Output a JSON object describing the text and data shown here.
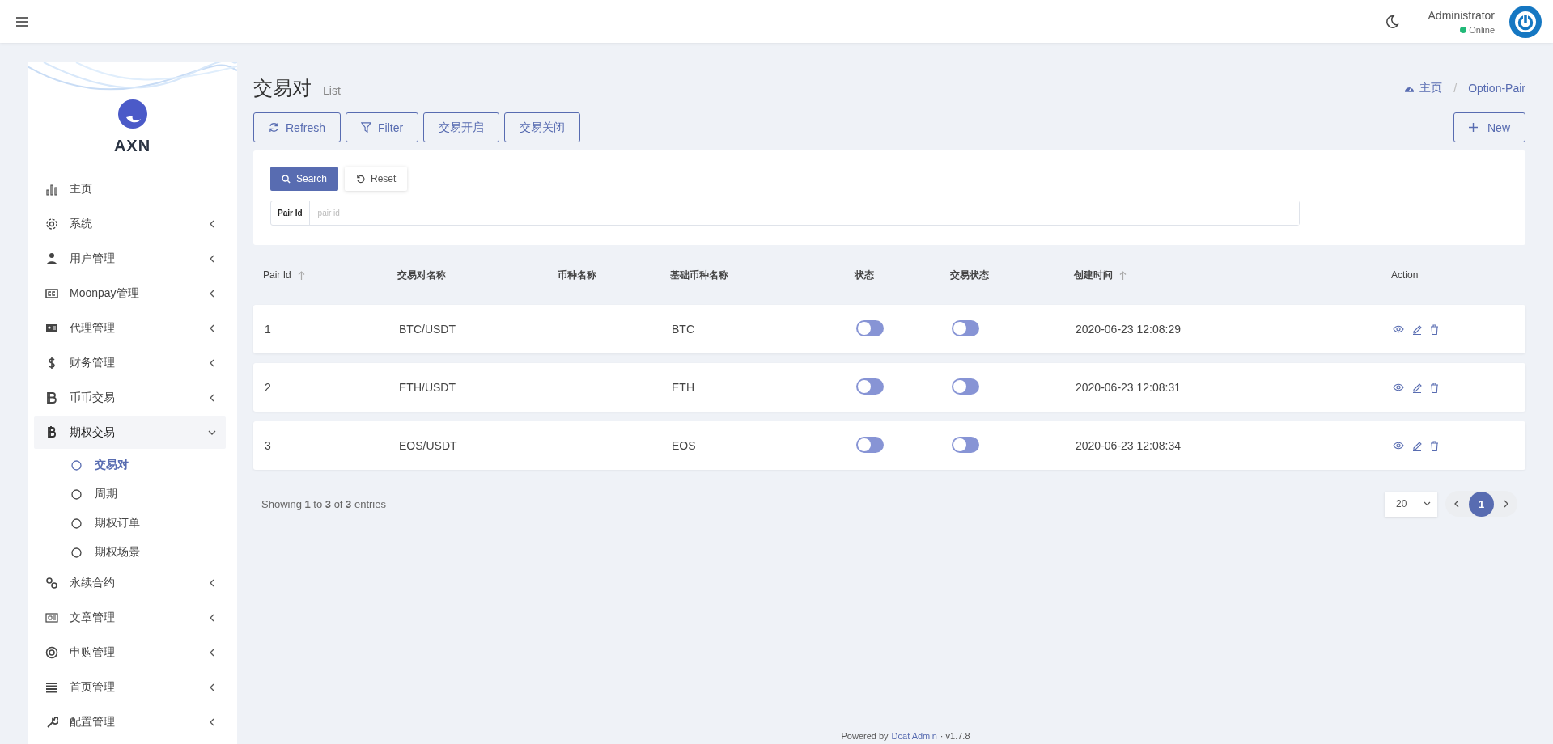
{
  "header": {
    "user_name": "Administrator",
    "user_status": "Online"
  },
  "sidebar": {
    "brand": "AXN",
    "items": [
      {
        "label": "主页",
        "selected": false
      },
      {
        "label": "系统",
        "selected": false,
        "expanded": false
      },
      {
        "label": "用户管理",
        "selected": false,
        "expanded": false
      },
      {
        "label": "Moonpay管理",
        "selected": false,
        "expanded": false
      },
      {
        "label": "代理管理",
        "selected": false,
        "expanded": false
      },
      {
        "label": "财务管理",
        "selected": false,
        "expanded": false
      },
      {
        "label": "币币交易",
        "selected": false,
        "expanded": false
      },
      {
        "label": "期权交易",
        "selected": true,
        "expanded": true,
        "children": [
          {
            "label": "交易对",
            "selected": true
          },
          {
            "label": "周期",
            "selected": false
          },
          {
            "label": "期权订单",
            "selected": false
          },
          {
            "label": "期权场景",
            "selected": false
          }
        ]
      },
      {
        "label": "永续合约",
        "selected": false,
        "expanded": false
      },
      {
        "label": "文章管理",
        "selected": false,
        "expanded": false
      },
      {
        "label": "申购管理",
        "selected": false,
        "expanded": false
      },
      {
        "label": "首页管理",
        "selected": false,
        "expanded": false
      },
      {
        "label": "配置管理",
        "selected": false,
        "expanded": false
      }
    ]
  },
  "page": {
    "title": "交易对",
    "subtitle": "List",
    "breadcrumb": [
      "主页",
      "Option-Pair"
    ],
    "breadcrumb_separator": "/"
  },
  "toolbar": {
    "buttons": [
      {
        "label": "Refresh",
        "kind": "refresh"
      },
      {
        "label": "Filter",
        "kind": "filter"
      },
      {
        "label": "交易开启",
        "kind": "plain"
      },
      {
        "label": "交易关闭",
        "kind": "plain"
      }
    ],
    "new_button": "New"
  },
  "filter": {
    "search_button": "Search",
    "reset_button": "Reset",
    "field_label": "Pair Id",
    "placeholder": "pair id"
  },
  "table": {
    "columns": [
      {
        "label": "Pair Id",
        "sortable": true
      },
      {
        "label": "交易对名称",
        "sortable": false
      },
      {
        "label": "币种名称",
        "sortable": false
      },
      {
        "label": "基础币种名称",
        "sortable": false
      },
      {
        "label": "状态",
        "sortable": false
      },
      {
        "label": "交易状态",
        "sortable": false
      },
      {
        "label": "创建时间",
        "sortable": true
      },
      {
        "label": "Action",
        "sortable": false
      }
    ],
    "rows": [
      {
        "id": "1",
        "pair": "BTC/USDT",
        "base": "BTC",
        "status_on": false,
        "trade_on": false,
        "created": "2020-06-23 12:08:29"
      },
      {
        "id": "2",
        "pair": "ETH/USDT",
        "base": "ETH",
        "status_on": false,
        "trade_on": false,
        "created": "2020-06-23 12:08:31"
      },
      {
        "id": "3",
        "pair": "EOS/USDT",
        "base": "EOS",
        "status_on": false,
        "trade_on": false,
        "created": "2020-06-23 12:08:34"
      }
    ]
  },
  "pagination": {
    "summary": "Showing **1** to **3** of **3** entries",
    "per_page": "20",
    "pages": [
      {
        "label": "1",
        "selected": true
      }
    ]
  },
  "footer": {
    "text": "Powered by",
    "link": "Dcat Admin",
    "version": "· v1.7.8"
  }
}
